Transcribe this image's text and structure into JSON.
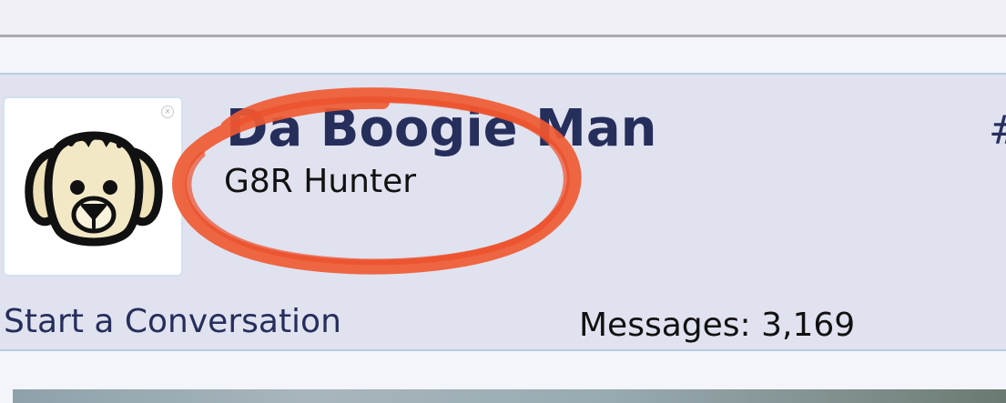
{
  "profile": {
    "username": "Da Boogie Man",
    "user_title": "G8R Hunter",
    "hash_mark": "#",
    "avatar_icon": "dog-face-icon",
    "start_conversation_label": "Start a Conversation",
    "messages_label": "Messages:",
    "messages_count": "3,169"
  },
  "colors": {
    "accent": "#262e5c",
    "card_background": "#e0e2ef",
    "annotation": "#ef5a33"
  }
}
